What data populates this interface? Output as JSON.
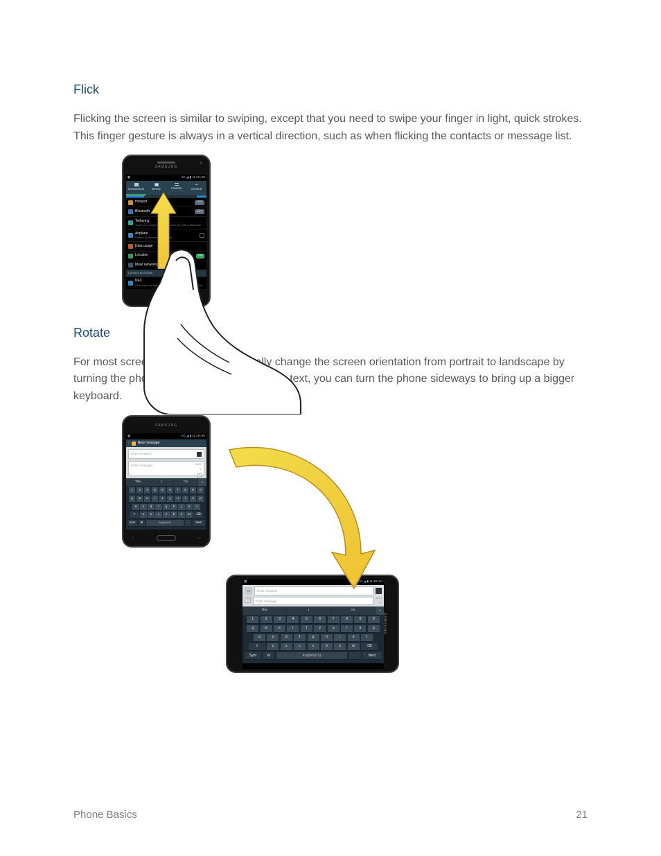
{
  "sections": {
    "flick": {
      "heading": "Flick",
      "paragraph": "Flicking the screen is similar to swiping, except that you need to swipe your finger in light, quick strokes. This finger gesture is always in a vertical direction, such as when flicking the contacts or message list."
    },
    "rotate": {
      "heading": "Rotate",
      "paragraph": "For most screens, you can automatically change the screen orientation from portrait to landscape by turning the phone sideways. When entering text, you can turn the phone sideways to bring up a bigger keyboard."
    }
  },
  "phone_flick": {
    "brand": "SAMSUNG",
    "status_time": "11:20 AM",
    "tabs": [
      "Connections",
      "Device",
      "Controls",
      "General"
    ],
    "rows": {
      "hotspot": {
        "label": "Hotspot",
        "state": "OFF"
      },
      "bluetooth": {
        "label": "Bluetooth",
        "state": "OFF"
      },
      "tethering": {
        "label": "Tethering",
        "sub": "Share your mobile data connection via USB or Bluetooth"
      },
      "airplane": {
        "label": "Airplane",
        "sub": "Disable all wireless connections"
      },
      "datausage": {
        "label": "Data usage"
      },
      "location": {
        "label": "Location",
        "state": "ON"
      },
      "morenet": {
        "label": "More networks"
      },
      "subheader": "Connect and share",
      "nfc": {
        "label": "NFC",
        "sub": "Allow data exchange when device touches another device"
      }
    }
  },
  "phone_rotate_portrait": {
    "brand": "SAMSUNG",
    "status_time": "11:29 AM",
    "title": "New message",
    "recipient_placeholder": "Enter recipient",
    "message_placeholder": "Enter message",
    "char_count": "160/1",
    "suggestions": [
      "The",
      "I",
      "I'm"
    ],
    "kbd_rows": [
      [
        "1",
        "2",
        "3",
        "4",
        "5",
        "6",
        "7",
        "8",
        "9",
        "0"
      ],
      [
        "q",
        "w",
        "e",
        "r",
        "t",
        "y",
        "u",
        "i",
        "o",
        "p"
      ],
      [
        "a",
        "s",
        "d",
        "f",
        "g",
        "h",
        "j",
        "k",
        "l"
      ],
      [
        "⇧",
        "z",
        "x",
        "c",
        "v",
        "b",
        "n",
        "m",
        "⌫"
      ],
      [
        "Sym",
        "⚙",
        "English(US)",
        ".",
        "Next"
      ]
    ]
  },
  "phone_rotate_landscape": {
    "status_time": "11:29 AM",
    "to_label": "To",
    "recipient_placeholder": "Enter recipient",
    "message_placeholder": "Enter message",
    "char_count": "160/1",
    "suggestions": [
      "The",
      "I",
      "I'm"
    ],
    "kbd_rows": [
      [
        "1",
        "2",
        "3",
        "4",
        "5",
        "6",
        "7",
        "8",
        "9",
        "0"
      ],
      [
        "q",
        "w",
        "e",
        "r",
        "t",
        "y",
        "u",
        "i",
        "o",
        "p"
      ],
      [
        "a",
        "s",
        "d",
        "f",
        "g",
        "h",
        "j",
        "k",
        "l"
      ],
      [
        "⇧",
        "z",
        "x",
        "c",
        "v",
        "b",
        "n",
        "m",
        "⌫"
      ],
      [
        "Sym",
        "⚙",
        "English(US)",
        ".",
        "Next"
      ]
    ]
  },
  "footer": {
    "section": "Phone Basics",
    "page": "21"
  }
}
